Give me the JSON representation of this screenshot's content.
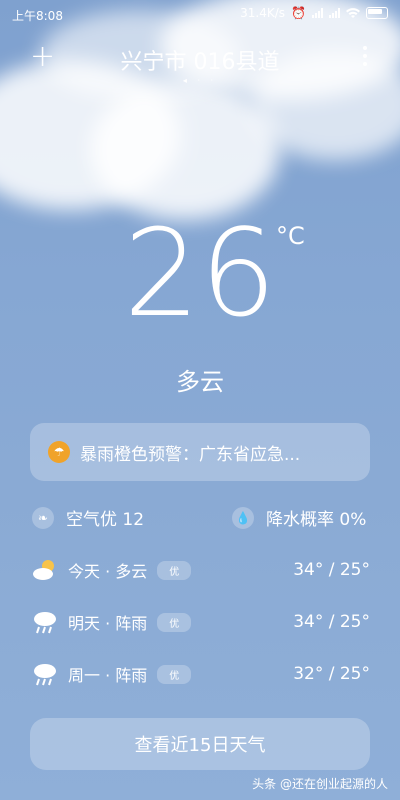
{
  "status_bar": {
    "time": "上午8:08",
    "network_speed": "31.4K/s"
  },
  "header": {
    "add_label": "+",
    "location": "兴宁市 016县道",
    "page_indicator": "◂ · ·"
  },
  "current": {
    "temperature": "26",
    "unit": "°C",
    "condition": "多云"
  },
  "alert": {
    "text": "暴雨橙色预警：广东省应急..."
  },
  "metrics": {
    "air_quality": "空气优 12",
    "precipitation": "降水概率 0%"
  },
  "forecast": [
    {
      "day": "今天 · 多云",
      "badge": "优",
      "range": "34° / 25°",
      "icon": "partly-cloudy-icon"
    },
    {
      "day": "明天 · 阵雨",
      "badge": "优",
      "range": "34° / 25°",
      "icon": "rain-icon"
    },
    {
      "day": "周一 · 阵雨",
      "badge": "优",
      "range": "32° / 25°",
      "icon": "rain-icon"
    }
  ],
  "button": {
    "label": "查看近15日天气"
  },
  "watermark": "头条 @还在创业起源的人",
  "colors": {
    "sky": "#86a7d3",
    "alert_icon": "#f0a32a"
  }
}
